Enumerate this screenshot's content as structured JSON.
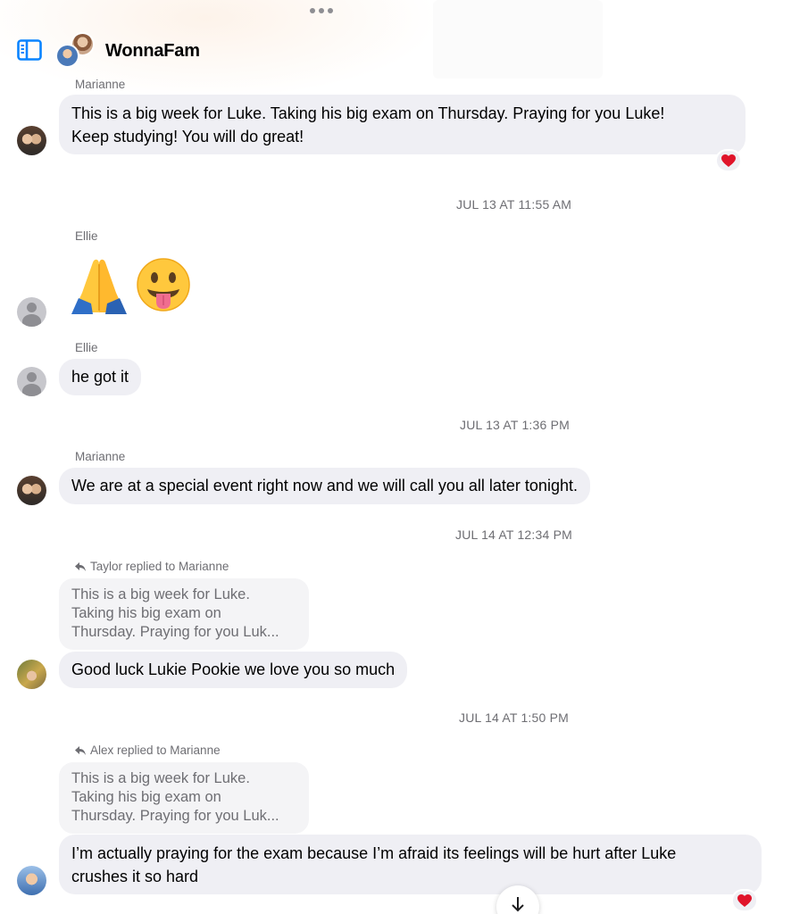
{
  "header": {
    "title": "WonnaFam",
    "icons": {
      "sidebar": "sidebar-toggle-icon",
      "more": "more-dots-icon"
    }
  },
  "colors": {
    "accent": "#0a84ff",
    "bubble": "#efeff4",
    "heart": "#e0142a",
    "meta_text": "#6e6e73"
  },
  "messages": [
    {
      "sender": "Marianne",
      "text_line1": "This is a big week for Luke. Taking his big exam on Thursday. Praying for you Luke!",
      "text_line2": "Keep studying!  You will do great!",
      "reaction": "heart-icon"
    },
    {
      "timestamp": "JUL 13 AT 11:55 AM"
    },
    {
      "sender": "Ellie",
      "emojis": [
        "folded-hands-emoji",
        "tongue-out-face-emoji"
      ]
    },
    {
      "sender": "Ellie",
      "text": "he got it"
    },
    {
      "timestamp": "JUL 13 AT 1:36 PM"
    },
    {
      "sender": "Marianne",
      "text": "We are at a special event right now and we will call you all later tonight."
    },
    {
      "timestamp": "JUL 14 AT 12:34 PM"
    },
    {
      "reply_label": "Taylor replied to Marianne",
      "quote_lines": [
        "This is a big week for Luke.",
        "Taking his big exam on",
        "Thursday. Praying for you Luk..."
      ],
      "text": "Good luck Lukie Pookie we love you so much"
    },
    {
      "timestamp": "JUL 14 AT 1:50 PM"
    },
    {
      "reply_label": "Alex replied to Marianne",
      "quote_lines": [
        "This is a big week for Luke.",
        "Taking his big exam on",
        "Thursday. Praying for you Luk..."
      ],
      "text_line1": "I’m actually praying for the exam because I’m afraid its feelings will be hurt after Luke",
      "text_line2": "crushes it so hard",
      "reaction": "heart-icon"
    }
  ],
  "scroll_down": {
    "icon": "arrow-down-icon"
  }
}
